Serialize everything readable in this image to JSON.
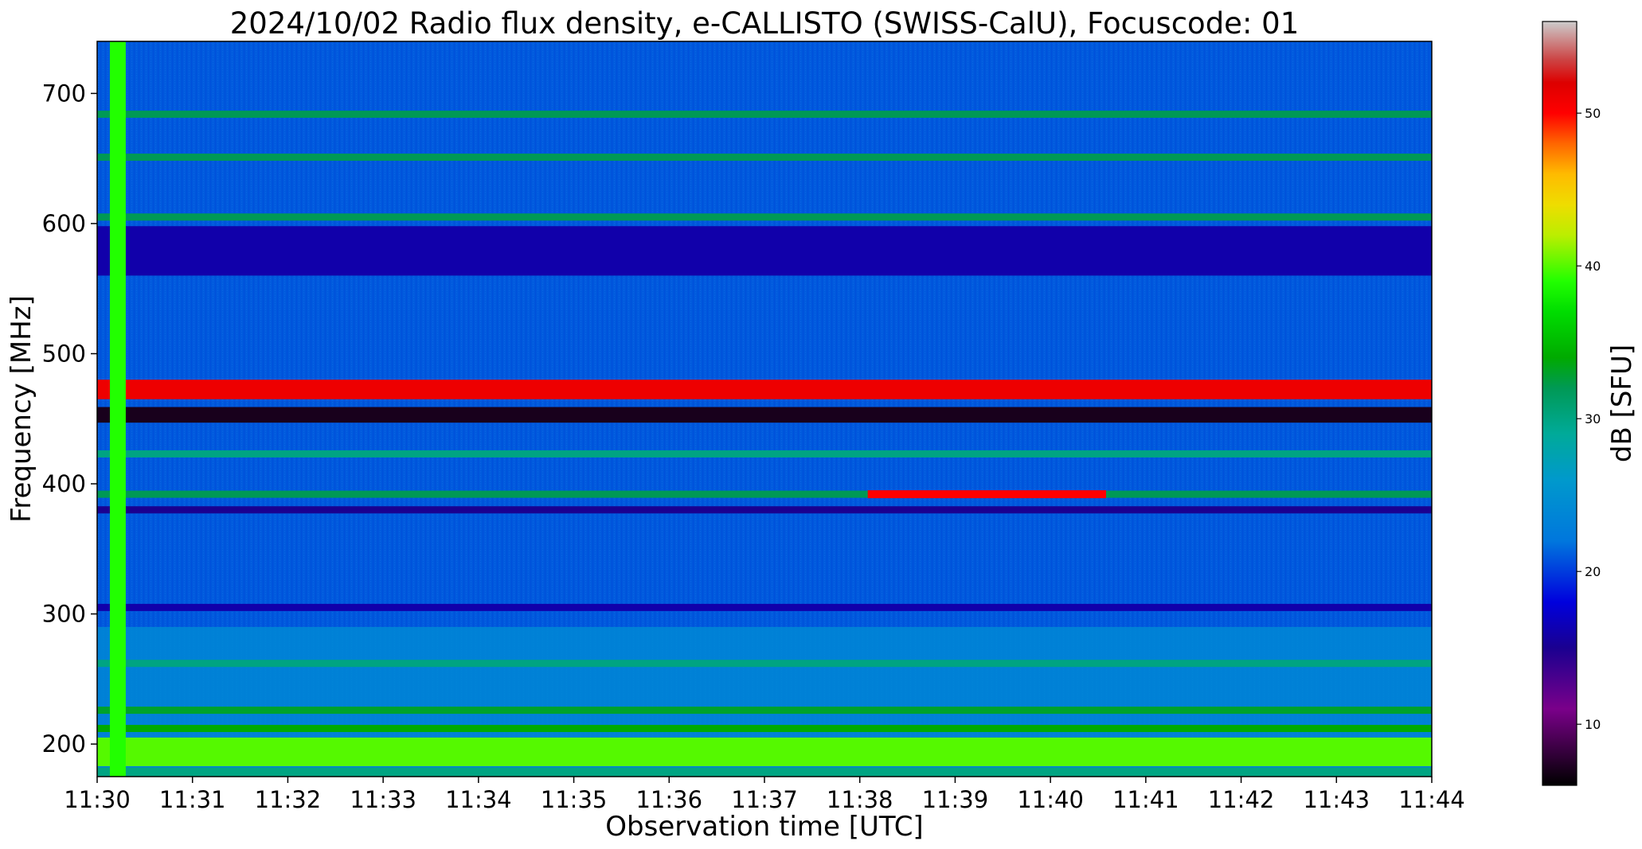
{
  "chart_data": {
    "type": "heatmap",
    "title": "2024/10/02  Radio flux density, e-CALLISTO (SWISS-CalU), Focuscode: 01",
    "xlabel": "Observation time [UTC]",
    "ylabel": "Frequency [MHz]",
    "colorbar_label": "dB [SFU]",
    "x_ticks": [
      "11:30",
      "11:31",
      "11:32",
      "11:33",
      "11:34",
      "11:35",
      "11:36",
      "11:37",
      "11:38",
      "11:39",
      "11:40",
      "11:41",
      "11:42",
      "11:43",
      "11:44"
    ],
    "y_ticks": [
      200,
      300,
      400,
      500,
      600,
      700
    ],
    "y_ticks_labels": [
      "200",
      "300",
      "400",
      "500",
      "600",
      "700"
    ],
    "colorbar_ticks": [
      10,
      20,
      30,
      40,
      50
    ],
    "colorbar_ticks_labels": [
      "10",
      "20",
      "30",
      "40",
      "50"
    ],
    "xlim": [
      "11:30",
      "11:44"
    ],
    "ylim": [
      175,
      740
    ],
    "clim": [
      6,
      56
    ],
    "colormap": "nipy_spectral",
    "background_level": 21,
    "features": [
      {
        "kind": "horizontal_band",
        "freq_mhz": 684,
        "level_db": 32
      },
      {
        "kind": "horizontal_band",
        "freq_mhz": 651,
        "level_db": 32
      },
      {
        "kind": "horizontal_band",
        "freq_mhz": 605,
        "level_db": 32
      },
      {
        "kind": "horizontal_band",
        "freq_range_mhz": [
          560,
          598
        ],
        "level_db": 16
      },
      {
        "kind": "horizontal_band",
        "freq_range_mhz": [
          465,
          480
        ],
        "level_db": 51
      },
      {
        "kind": "horizontal_band",
        "freq_range_mhz": [
          447,
          459
        ],
        "level_db": 7
      },
      {
        "kind": "horizontal_band",
        "freq_mhz": 423,
        "level_db": 30
      },
      {
        "kind": "horizontal_band",
        "freq_mhz": 392,
        "level_db": 32
      },
      {
        "kind": "horizontal_band",
        "freq_mhz": 380,
        "level_db": 15
      },
      {
        "kind": "horizontal_band",
        "freq_mhz": 305,
        "level_db": 16
      },
      {
        "kind": "horizontal_band",
        "freq_mhz": 262,
        "level_db": 30
      },
      {
        "kind": "horizontal_band",
        "freq_mhz": 226,
        "level_db": 33
      },
      {
        "kind": "horizontal_band",
        "freq_mhz": 212,
        "level_db": 34
      },
      {
        "kind": "horizontal_band",
        "freq_range_mhz": [
          183,
          205
        ],
        "level_db": 40
      },
      {
        "kind": "horizontal_band",
        "freq_range_mhz": [
          175,
          182
        ],
        "level_db": 30
      },
      {
        "kind": "burst_segment",
        "time_range": [
          "11:38:05",
          "11:40:35"
        ],
        "freq_mhz": 392,
        "level_db": 50
      },
      {
        "kind": "vertical_stripe",
        "time_range": [
          "11:30:08",
          "11:30:18"
        ],
        "level_db": 39
      }
    ]
  }
}
